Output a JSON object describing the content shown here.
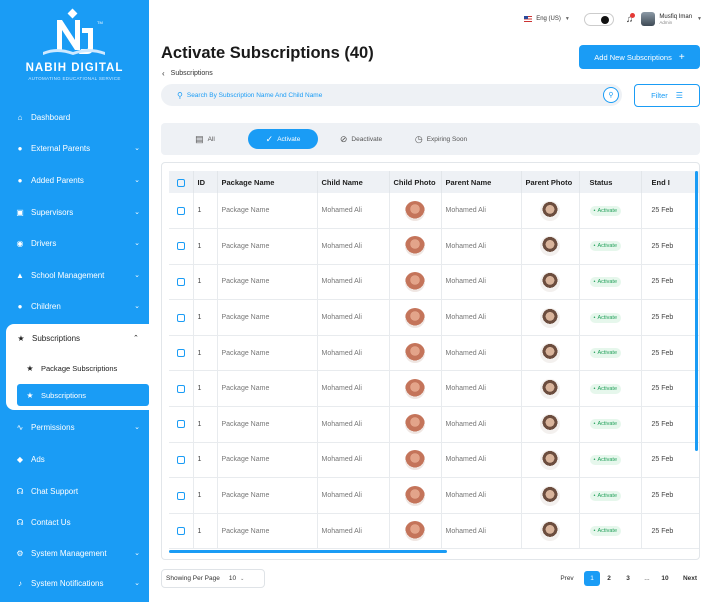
{
  "brand": {
    "name": "NABIH DIGITAL",
    "tagline": "AUTOMATING EDUCATIONAL SERVICE"
  },
  "topbar": {
    "language": "Eng (US)",
    "user_name": "Musfiq Iman",
    "user_role": "Admin"
  },
  "sidebar": {
    "items": [
      {
        "label": "Dashboard",
        "icon": "home-icon"
      },
      {
        "label": "External Parents",
        "icon": "person-icon"
      },
      {
        "label": "Added Parents",
        "icon": "person-icon"
      },
      {
        "label": "Supervisors",
        "icon": "id-card-icon"
      },
      {
        "label": "Drivers",
        "icon": "steering-icon"
      },
      {
        "label": "School Management",
        "icon": "school-icon"
      },
      {
        "label": "Children",
        "icon": "child-icon"
      },
      {
        "label": "Subscriptions",
        "icon": "star-icon"
      },
      {
        "label": "Package Subscriptions",
        "icon": "star-icon"
      },
      {
        "label": "Subscriptions",
        "icon": "star-icon"
      },
      {
        "label": "Permissions",
        "icon": "permissions-icon"
      },
      {
        "label": "Ads",
        "icon": "tag-icon"
      },
      {
        "label": "Chat Support",
        "icon": "headset-icon"
      },
      {
        "label": "Contact Us",
        "icon": "headset-icon"
      },
      {
        "label": "System Management",
        "icon": "gear-icon"
      },
      {
        "label": "System Notifications",
        "icon": "bell-icon"
      }
    ]
  },
  "header": {
    "title": "Activate Subscriptions (40)",
    "breadcrumb": "Subscriptions",
    "add_button": "Add New Subscriptions",
    "search_placeholder": "Search By Subscription Name And Child Name",
    "filter_button": "Filter"
  },
  "tabs": [
    "All",
    "Activate",
    "Deactivate",
    "Expiring Soon"
  ],
  "table": {
    "columns": [
      "ID",
      "Package  Name",
      "Child Name",
      "Child Photo",
      "Parent Name",
      "Parent Photo",
      "Status",
      "End I"
    ],
    "rows": [
      {
        "id": "1",
        "package": "Package  Name",
        "child": "Mohamed Ali",
        "parent": "Mohamed Ali",
        "status": "Activate",
        "end": "25 Feb"
      },
      {
        "id": "1",
        "package": "Package  Name",
        "child": "Mohamed Ali",
        "parent": "Mohamed Ali",
        "status": "Activate",
        "end": "25 Feb"
      },
      {
        "id": "1",
        "package": "Package  Name",
        "child": "Mohamed Ali",
        "parent": "Mohamed Ali",
        "status": "Activate",
        "end": "25 Feb"
      },
      {
        "id": "1",
        "package": "Package  Name",
        "child": "Mohamed Ali",
        "parent": "Mohamed Ali",
        "status": "Activate",
        "end": "25 Feb"
      },
      {
        "id": "1",
        "package": "Package  Name",
        "child": "Mohamed Ali",
        "parent": "Mohamed Ali",
        "status": "Activate",
        "end": "25 Feb"
      },
      {
        "id": "1",
        "package": "Package  Name",
        "child": "Mohamed Ali",
        "parent": "Mohamed Ali",
        "status": "Activate",
        "end": "25 Feb"
      },
      {
        "id": "1",
        "package": "Package  Name",
        "child": "Mohamed Ali",
        "parent": "Mohamed Ali",
        "status": "Activate",
        "end": "25 Feb"
      },
      {
        "id": "1",
        "package": "Package  Name",
        "child": "Mohamed Ali",
        "parent": "Mohamed Ali",
        "status": "Activate",
        "end": "25 Feb"
      },
      {
        "id": "1",
        "package": "Package  Name",
        "child": "Mohamed Ali",
        "parent": "Mohamed Ali",
        "status": "Activate",
        "end": "25 Feb"
      },
      {
        "id": "1",
        "package": "Package  Name",
        "child": "Mohamed Ali",
        "parent": "Mohamed Ali",
        "status": "Activate",
        "end": "25 Feb"
      }
    ]
  },
  "footer": {
    "per_page_label": "Showing Per Page",
    "per_page_value": "10",
    "prev": "Prev",
    "pages": [
      "1",
      "2",
      "3",
      "...",
      "10"
    ],
    "next": "Next"
  },
  "colors": {
    "accent": "#1a9cf5",
    "status_bg": "#e6f7ec",
    "status_text": "#22a05a"
  }
}
